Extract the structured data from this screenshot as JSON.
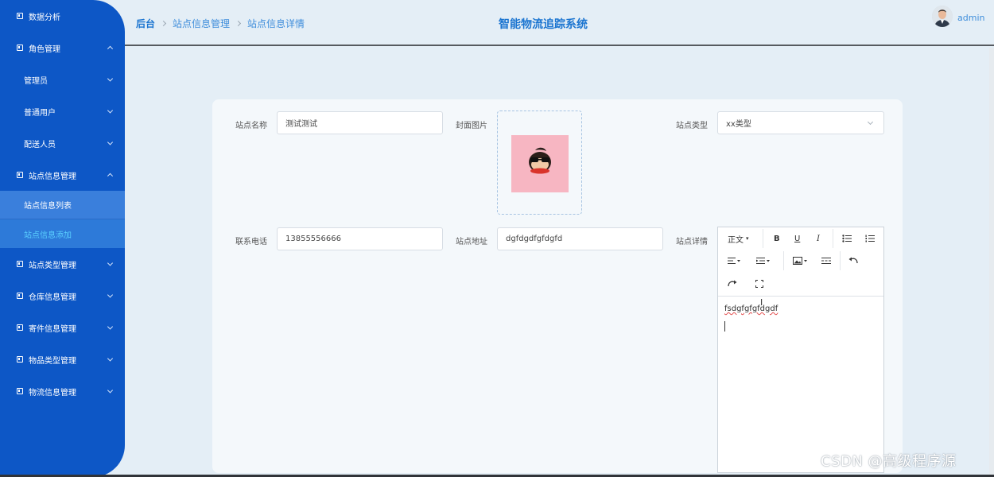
{
  "sidebar": {
    "items": [
      {
        "label": "数据分析"
      },
      {
        "label": "角色管理"
      },
      {
        "label": "管理员"
      },
      {
        "label": "普通用户"
      },
      {
        "label": "配送人员"
      },
      {
        "label": "站点信息管理"
      },
      {
        "label": "站点信息列表"
      },
      {
        "label": "站点信息添加"
      },
      {
        "label": "站点类型管理"
      },
      {
        "label": "仓库信息管理"
      },
      {
        "label": "寄件信息管理"
      },
      {
        "label": "物品类型管理"
      },
      {
        "label": "物流信息管理"
      }
    ]
  },
  "header": {
    "breadcrumb": [
      "后台",
      "站点信息管理",
      "站点信息详情"
    ],
    "title": "智能物流追踪系统",
    "user": "admin"
  },
  "form": {
    "name_label": "站点名称",
    "name_value": "测试测试",
    "cover_label": "封面图片",
    "type_label": "站点类型",
    "type_value": "xx类型",
    "phone_label": "联系电话",
    "phone_value": "13855556666",
    "address_label": "站点地址",
    "address_value": "dgfdgdfgfdgfd",
    "detail_label": "站点详情"
  },
  "editor": {
    "heading_select": "正文",
    "content": "fsdgfgfgfdgdf"
  },
  "watermark": "CSDN @高级程序源",
  "colors": {
    "sidebar": "#0d57c6",
    "accent": "#1a74d0",
    "active_link": "#5ad0ff"
  }
}
